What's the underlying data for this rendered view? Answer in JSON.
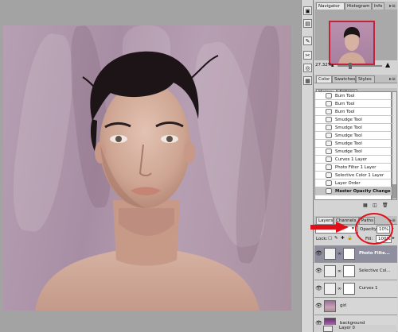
{
  "navigator": {
    "tabs": [
      "Navigator",
      "Histogram",
      "Info"
    ],
    "zoom": "27.32%"
  },
  "color_panel": {
    "tabs": [
      "Color",
      "Swatches",
      "Styles"
    ]
  },
  "history": {
    "tabs": [
      "History",
      "Actions"
    ],
    "items": [
      {
        "label": "Burn Tool",
        "icon": "brush-icon"
      },
      {
        "label": "Burn Tool",
        "icon": "brush-icon"
      },
      {
        "label": "Burn Tool",
        "icon": "brush-icon"
      },
      {
        "label": "Smudge Tool",
        "icon": "smudge-icon"
      },
      {
        "label": "Smudge Tool",
        "icon": "smudge-icon"
      },
      {
        "label": "Smudge Tool",
        "icon": "smudge-icon"
      },
      {
        "label": "Smudge Tool",
        "icon": "smudge-icon"
      },
      {
        "label": "Smudge Tool",
        "icon": "smudge-icon"
      },
      {
        "label": "Curves 1 Layer",
        "icon": "layer-icon"
      },
      {
        "label": "Photo Filter 1 Layer",
        "icon": "layer-icon"
      },
      {
        "label": "Selective Color 1 Layer",
        "icon": "layer-icon"
      },
      {
        "label": "Layer Order",
        "icon": "layer-icon"
      },
      {
        "label": "Master Opacity Change",
        "icon": "layer-icon",
        "selected": true
      }
    ]
  },
  "layers": {
    "tabs": [
      "Layers",
      "Channels",
      "Paths"
    ],
    "opacity_label": "Opacity:",
    "opacity_value": "10%",
    "lock_label": "Lock:",
    "fill_label": "Fill:",
    "fill_value": "100%",
    "items": [
      {
        "name": "Photo Filte...",
        "selected": true
      },
      {
        "name": "Selective Col..."
      },
      {
        "name": "Curves 1"
      },
      {
        "name": "girl"
      },
      {
        "name": "background"
      },
      {
        "name": "Layer 0"
      }
    ]
  },
  "colors": {
    "annotation_red": "#e0101a",
    "selection_row": "#8f8f9f",
    "backdrop": "#b7a0b3"
  }
}
